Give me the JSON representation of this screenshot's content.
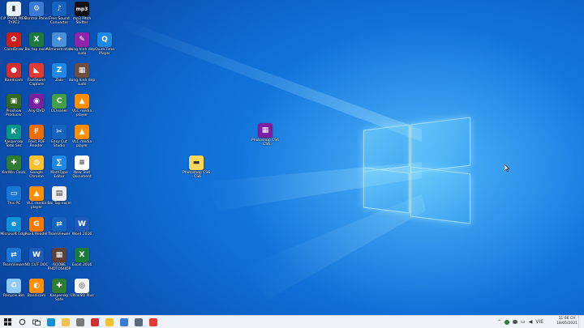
{
  "desktop_icons": [
    {
      "label": "C# PHAN MEM TYPE3",
      "color": "#e8f1ff",
      "glyph": "▮",
      "name": "icon-1"
    },
    {
      "label": "Control Panel",
      "color": "#3a7bd5",
      "glyph": "⚙",
      "name": "control-panel-icon"
    },
    {
      "label": "Free Sound Converter",
      "color": "#1565c0",
      "glyph": "♪",
      "name": "sound-converter-icon"
    },
    {
      "label": "mp3 Pitch Shifter",
      "color": "#111111",
      "glyph": "mp3",
      "name": "mp3-pitch-shifter-icon"
    },
    {
      "label": "CorelDraw",
      "color": "#cc1e1e",
      "glyph": "✿",
      "name": "coreldraw-icon"
    },
    {
      "label": "Bai tap excel",
      "color": "#1d7a3e",
      "glyph": "X",
      "name": "excel-file-icon"
    },
    {
      "label": "Administration",
      "color": "#4a90d9",
      "glyph": "✦",
      "name": "admin-tools-icon"
    },
    {
      "label": "dung hinh dep sudo",
      "color": "#8e24aa",
      "glyph": "✎",
      "name": "design-tool-icon"
    },
    {
      "label": "QuickTime Player",
      "color": "#1e88e5",
      "glyph": "Q",
      "name": "quicktime-icon"
    },
    {
      "label": "Bandicam",
      "color": "#d32f2f",
      "glyph": "●",
      "name": "bandicam-icon"
    },
    {
      "label": "FastStone Capture",
      "color": "#e53935",
      "glyph": "◣",
      "name": "faststone-icon"
    },
    {
      "label": "Zalo",
      "color": "#1e88e5",
      "glyph": "Z",
      "name": "zalo-icon"
    },
    {
      "label": "dung hinh dep sudo",
      "color": "#6d4c41",
      "glyph": "▦",
      "name": "photo-app-icon"
    },
    {
      "label": "Proshow Producer",
      "color": "#33691e",
      "glyph": "▣",
      "name": "proshow-icon"
    },
    {
      "label": "Any DVD",
      "color": "#7b1fa2",
      "glyph": "◉",
      "name": "dvd-icon"
    },
    {
      "label": "CCleaner",
      "color": "#43a047",
      "glyph": "C",
      "name": "ccleaner-icon"
    },
    {
      "label": "VLC media player",
      "color": "#ff8f00",
      "glyph": "▲",
      "name": "vlc-icon"
    },
    {
      "label": "Kaspersky Total Sec",
      "color": "#009688",
      "glyph": "K",
      "name": "kaspersky-icon"
    },
    {
      "label": "Foxit PDF Reader",
      "color": "#ef6c00",
      "glyph": "F",
      "name": "foxit-icon"
    },
    {
      "label": "Easy Cut Studio",
      "color": "#1565c0",
      "glyph": "✂",
      "name": "cut-studio-icon"
    },
    {
      "label": "VLC media player",
      "color": "#ff8f00",
      "glyph": "▲",
      "name": "vlc-icon-2"
    },
    {
      "label": "KarWin Clock",
      "color": "#2e7d32",
      "glyph": "✚",
      "name": "karwin-icon"
    },
    {
      "label": "Google Chrome",
      "color": "#fbc02d",
      "glyph": "◍",
      "name": "chrome-icon"
    },
    {
      "label": "MathType Editor",
      "color": "#1e88e5",
      "glyph": "∑",
      "name": "mathtype-icon"
    },
    {
      "label": "New Text Document",
      "color": "#ffffff",
      "glyph": "≡",
      "name": "text-doc-icon"
    },
    {
      "label": "This PC",
      "color": "#1976d2",
      "glyph": "▭",
      "name": "this-pc-icon"
    },
    {
      "label": "VLC media player",
      "color": "#ff8f00",
      "glyph": "▲",
      "name": "vlc-icon-3"
    },
    {
      "label": "Bai Tap excel",
      "color": "#eeeeee",
      "glyph": "▤",
      "name": "sheet-icon"
    },
    {
      "label": "Microsoft Edge",
      "color": "#0f8fd6",
      "glyph": "e",
      "name": "edge-icon"
    },
    {
      "label": "Foxit Reader",
      "color": "#f57c00",
      "glyph": "G",
      "name": "foxit-reader-icon"
    },
    {
      "label": "TeamViewer",
      "color": "#1565c0",
      "glyph": "⇄",
      "name": "teamviewer-icon"
    },
    {
      "label": "Word 2016",
      "color": "#1e5bb8",
      "glyph": "W",
      "name": "word-icon"
    },
    {
      "label": "TeamViewer",
      "color": "#1976d2",
      "glyph": "⇄",
      "name": "teamviewer-icon-2"
    },
    {
      "label": "NO CUT DOC",
      "color": "#1e5bb8",
      "glyph": "W",
      "name": "word-doc-icon"
    },
    {
      "label": "ADOBE PHOTOSHOP",
      "color": "#5d4037",
      "glyph": "▦",
      "name": "photoshop-folder-icon"
    },
    {
      "label": "Excel 2016",
      "color": "#1d7a3e",
      "glyph": "X",
      "name": "excel-icon"
    },
    {
      "label": "Recycle Bin",
      "color": "#90caf9",
      "glyph": "♻",
      "name": "recycle-bin-icon"
    },
    {
      "label": "Bandicam",
      "color": "#ff8f00",
      "glyph": "◐",
      "name": "bandicam-2-icon"
    },
    {
      "label": "Kaspersky Safe",
      "color": "#2e7d32",
      "glyph": "✚",
      "name": "kaspersky-safe-icon"
    },
    {
      "label": "UltraISO Plus",
      "color": "#f5f5f5",
      "glyph": "◎",
      "name": "ultraiso-icon"
    }
  ],
  "free_icons": [
    {
      "label": "Photoshop CS6 - CS6",
      "color": "#7b1fa2",
      "glyph": "▦",
      "name": "winrar-archive-icon"
    },
    {
      "label": "Photoshop CS6 - CS6",
      "color": "#f9d65c",
      "glyph": "▬",
      "name": "folder-icon"
    }
  ],
  "taskbar": {
    "apps": [
      {
        "name": "taskbar-edge-icon",
        "color": "#0f8fd6"
      },
      {
        "name": "taskbar-explorer-icon",
        "color": "#f2c14e"
      },
      {
        "name": "taskbar-store-icon",
        "color": "#7a7a7a"
      },
      {
        "name": "taskbar-bandicam-icon",
        "color": "#d32f2f"
      },
      {
        "name": "taskbar-chrome-icon",
        "color": "#fbc02d"
      },
      {
        "name": "taskbar-folder-icon",
        "color": "#3a7bd5"
      },
      {
        "name": "taskbar-window-icon",
        "color": "#5a6b80"
      },
      {
        "name": "taskbar-chrome-2-icon",
        "color": "#e53935"
      }
    ],
    "clock_time": "11:06 CH",
    "clock_date": "18/05/2021",
    "language": "VIE"
  }
}
